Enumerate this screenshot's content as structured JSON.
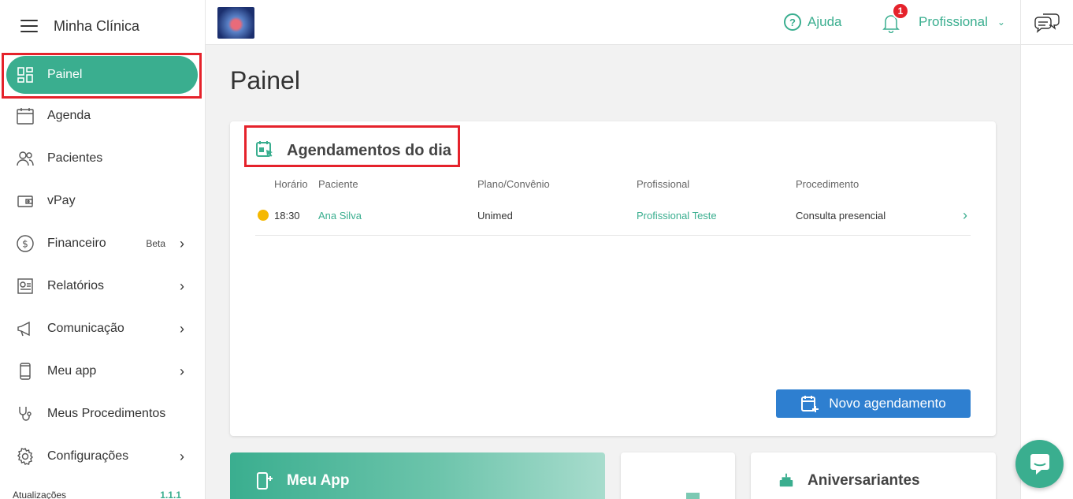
{
  "sidebar": {
    "title": "Minha Clínica",
    "active_label": "Painel",
    "items": [
      {
        "label": "Agenda"
      },
      {
        "label": "Pacientes"
      },
      {
        "label": "vPay"
      },
      {
        "label": "Financeiro",
        "badge": "Beta"
      },
      {
        "label": "Relatórios"
      },
      {
        "label": "Comunicação"
      },
      {
        "label": "Meu app"
      },
      {
        "label": "Meus Procedimentos"
      },
      {
        "label": "Configurações"
      }
    ],
    "footer_label": "Atualizações",
    "footer_version": "1.1.1"
  },
  "topbar": {
    "help_label": "Ajuda",
    "help_glyph": "?",
    "notification_count": "1",
    "profile_label": "Profissional"
  },
  "page": {
    "title": "Painel"
  },
  "appointments": {
    "title": "Agendamentos do dia",
    "columns": [
      "Horário",
      "Paciente",
      "Plano/Convênio",
      "Profissional",
      "Procedimento"
    ],
    "rows": [
      {
        "time": "18:30",
        "patient": "Ana Silva",
        "plan": "Unimed",
        "professional": "Profissional Teste",
        "procedure": "Consulta presencial"
      }
    ],
    "new_button": "Novo agendamento"
  },
  "cards": {
    "meuapp_title": "Meu App",
    "birthdays_title": "Aniversariantes"
  },
  "colors": {
    "accent": "#3aae8f",
    "button_blue": "#2e7fd0",
    "highlight_red": "#e5222b",
    "status_dot": "#f5b800"
  }
}
